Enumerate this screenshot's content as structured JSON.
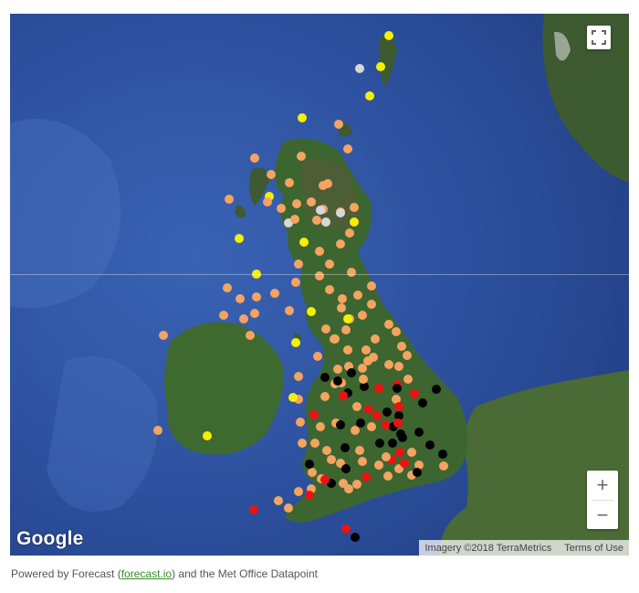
{
  "map": {
    "attribution": "Imagery ©2018 TerraMetrics",
    "terms_label": "Terms of Use",
    "logo_text": "Google",
    "zoom_in_label": "+",
    "zoom_out_label": "−"
  },
  "colors": {
    "ocean": "#2c4f9c",
    "land": "#3f5f32",
    "yellow": "#f5f000",
    "orange": "#f4a460",
    "grey": "#d8d8d8",
    "red": "#ee1111",
    "black": "#000000"
  },
  "footer": {
    "prefix": "Powered by Forecast (",
    "link_text": "forecast.io",
    "suffix": ") and the Met Office Datapoint"
  }
}
